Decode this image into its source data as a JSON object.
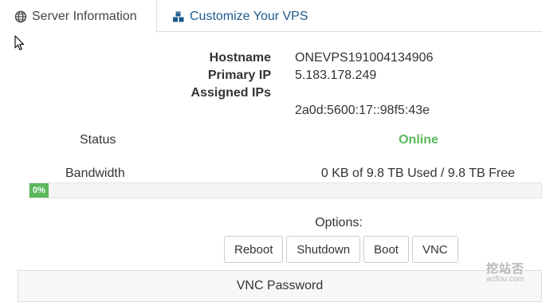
{
  "tabs": [
    {
      "label": "Server Information",
      "icon": "globe-icon",
      "active": true
    },
    {
      "label": "Customize Your VPS",
      "icon": "cubes-icon",
      "active": false
    }
  ],
  "server": {
    "hostname_label": "Hostname",
    "hostname": "ONEVPS191004134906",
    "primary_ip_label": "Primary IP",
    "primary_ip": "5.183.178.249",
    "assigned_ips_label": "Assigned IPs",
    "assigned_ip": "2a0d:5600:17::98f5:43e"
  },
  "status": {
    "label": "Status",
    "value": "Online",
    "color": "#5cb85c"
  },
  "bandwidth": {
    "label": "Bandwidth",
    "value": "0 KB of 9.8 TB Used / 9.8 TB Free",
    "percent_label": "0%",
    "percent": 0
  },
  "options": {
    "label": "Options:",
    "buttons": [
      "Reboot",
      "Shutdown",
      "Boot",
      "VNC"
    ]
  },
  "vnc": {
    "title": "VNC Password"
  },
  "watermark": {
    "cn": "挖站否",
    "en": "wzfou.com"
  },
  "colors": {
    "link": "#1e5a8e",
    "success": "#5cb85c",
    "border": "#dddddd"
  }
}
